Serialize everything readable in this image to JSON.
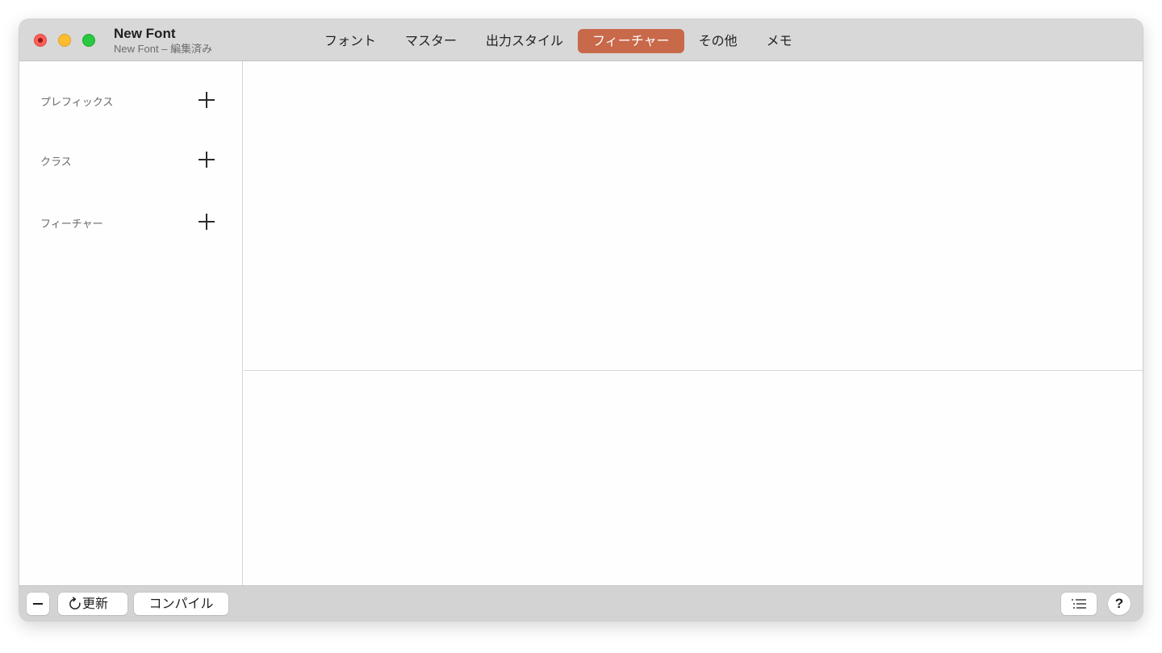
{
  "window": {
    "title": "New Font",
    "subtitle": "New Font – 編集済み"
  },
  "tabs": [
    {
      "label": "フォント",
      "active": false
    },
    {
      "label": "マスター",
      "active": false
    },
    {
      "label": "出力スタイル",
      "active": false
    },
    {
      "label": "フィーチャー",
      "active": true
    },
    {
      "label": "その他",
      "active": false
    },
    {
      "label": "メモ",
      "active": false
    }
  ],
  "sidebar": {
    "sections": [
      {
        "label": "プレフィックス",
        "add_icon": "plus-icon"
      },
      {
        "label": "クラス",
        "add_icon": "plus-icon"
      },
      {
        "label": "フィーチャー",
        "add_icon": "plus-icon"
      }
    ]
  },
  "bottombar": {
    "remove_icon": "minus-icon",
    "update_label": "更新",
    "update_icon": "refresh-icon",
    "compile_label": "コンパイル",
    "list_icon": "list-icon",
    "help_label": "?"
  },
  "colors": {
    "active_tab": "#c8694a",
    "titlebar": "#d8d8d8",
    "bottombar": "#d3d3d3"
  }
}
